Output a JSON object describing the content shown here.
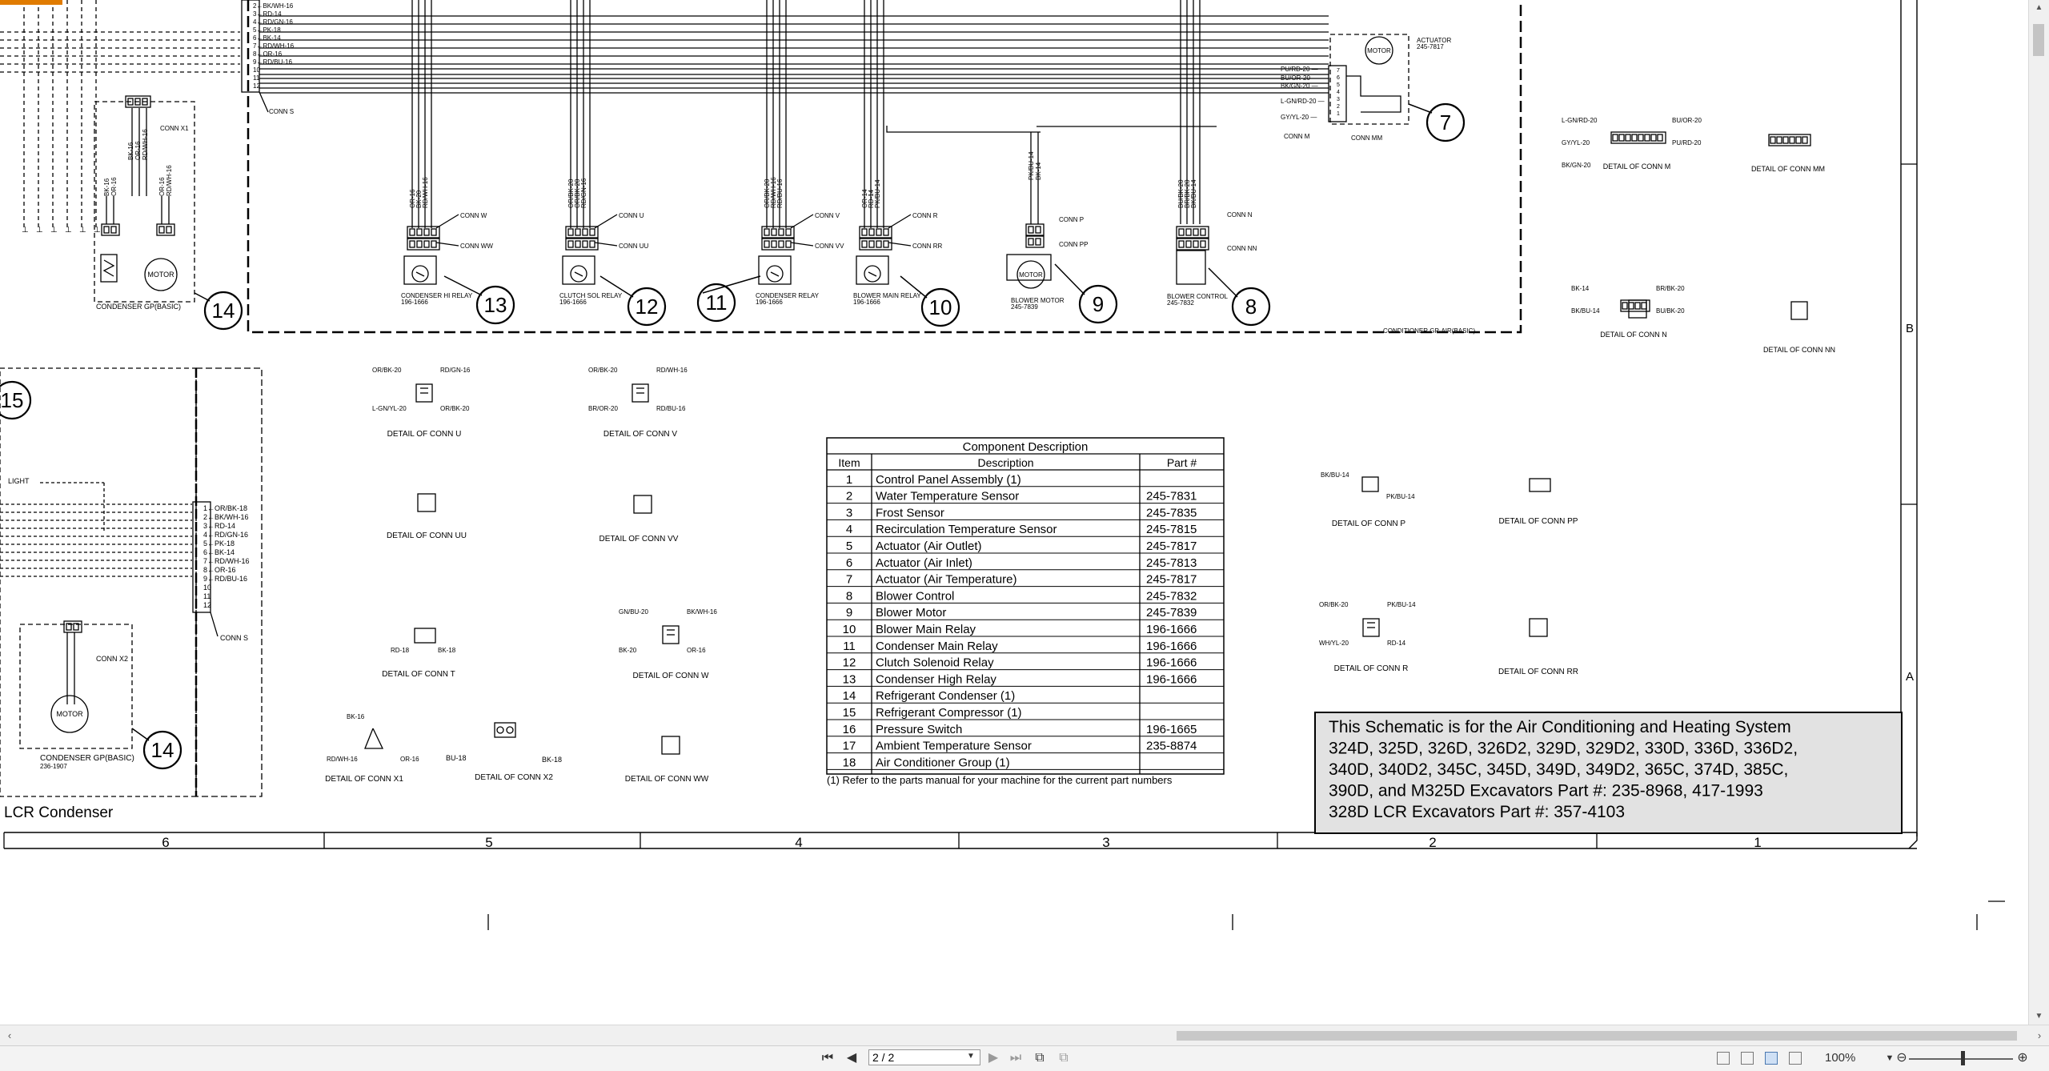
{
  "diagram": {
    "top_wires": [
      "2←BK/WH-16",
      "3←RD-14",
      "4←RD/GN-16",
      "5←PK-18",
      "6←BK-14",
      "7←RD/WH-16",
      "8←OR-16",
      "9←RD/BU-16",
      "10",
      "11",
      "12"
    ],
    "conn_s": "CONN S",
    "conn_x1": "CONN X1",
    "conn_x1_wires": [
      "BK-16",
      "OR-16",
      "RD/WH-16"
    ],
    "left_wires_a": [
      "BK-16",
      "OR-16"
    ],
    "left_wires_b": [
      "OR-16",
      "RD/WH-16"
    ],
    "motor": "MOTOR",
    "condenser_gp_top": "CONDENSER GP(BASIC)",
    "callouts": [
      "14",
      "13",
      "12",
      "11",
      "10",
      "9",
      "8",
      "7",
      "15",
      "14"
    ],
    "cond_hi_relay": {
      "name": "CONDENSER HI RELAY",
      "part": "196-1666",
      "conn_a": "CONN W",
      "conn_b": "CONN WW",
      "wires": [
        "OR-16",
        "BK-20",
        "RD/WH-16"
      ]
    },
    "clutch_sol_relay": {
      "name": "CLUTCH SOL RELAY",
      "part": "196-1666",
      "conn_a": "CONN U",
      "conn_b": "CONN UU",
      "wires": [
        "OR/BK-20",
        "OR/BK-20",
        "RD/GN-16"
      ]
    },
    "condenser_relay": {
      "name": "CONDENSER RELAY",
      "part": "196-1666",
      "conn_a": "CONN V",
      "conn_b": "CONN VV",
      "wires": [
        "OR/BK-20",
        "RD/WH-16",
        "RD/BU-16"
      ]
    },
    "blower_main_relay": {
      "name": "BLOWER MAIN RELAY",
      "part": "196-1666",
      "conn_a": "CONN R",
      "conn_b": "CONN RR",
      "wires": [
        "OR-14",
        "RD-14",
        "PK/BU-14"
      ]
    },
    "blower_motor": {
      "name": "BLOWER MOTOR",
      "part": "245-7839",
      "conn_a": "CONN P",
      "conn_b": "CONN PP",
      "wires": [
        "PK/BU-14",
        "BK-14"
      ]
    },
    "blower_control": {
      "name": "BLOWER CONTROL",
      "part": "245-7832",
      "conn_a": "CONN N",
      "conn_b": "CONN NN",
      "wires": [
        "BU/BK-20",
        "BR/BK-20",
        "BK/BU-14"
      ]
    },
    "actuator": {
      "name": "ACTUATOR",
      "part": "245-7817",
      "motor": "MOTOR",
      "wires": [
        "PU/RD-20",
        "BU/OR-20",
        "BK/GN-20",
        "L-GN/RD-20",
        "GY/YL-20"
      ],
      "conn_m": "CONN M",
      "conn_mm": "CONN MM"
    },
    "conditioner_gp": "CONDITIONER GP-AIR(BASIC)",
    "details_right": [
      {
        "title": "DETAIL OF CONN M",
        "wires": [
          "L-GN/RD-20",
          "BU/OR-20",
          "GY/YL-20",
          "PU/RD-20",
          "BK/GN-20"
        ]
      },
      {
        "title": "DETAIL OF CONN MM",
        "wires": []
      },
      {
        "title": "DETAIL OF CONN N",
        "wires": [
          "BK-14",
          "BR/BK-20",
          "BK/BU-14",
          "BU/BK-20"
        ]
      },
      {
        "title": "DETAIL OF CONN NN",
        "wires": []
      }
    ],
    "conn_u_detail": {
      "title": "DETAIL OF CONN U",
      "wires": [
        "OR/BK-20",
        "RD/GN-16",
        "L-GN/YL-20",
        "OR/BK-20"
      ]
    },
    "conn_v_detail": {
      "title": "DETAIL OF CONN V",
      "wires": [
        "OR/BK-20",
        "RD/WH-16",
        "BR/OR-20",
        "RD/BU-16"
      ]
    },
    "conn_uu_detail": "DETAIL OF CONN UU",
    "conn_vv_detail": "DETAIL OF CONN VV",
    "conn_t_detail": {
      "title": "DETAIL OF CONN T",
      "wires": [
        "RD-18",
        "BK-18"
      ]
    },
    "conn_w_detail": {
      "title": "DETAIL OF CONN W",
      "wires": [
        "GN/BU-20",
        "BK/WH-16",
        "BK-20",
        "OR-16"
      ]
    },
    "conn_x1_detail": {
      "title": "DETAIL OF CONN X1",
      "wires": [
        "BK-16",
        "RD/WH-16",
        "OR-16"
      ]
    },
    "conn_x2_detail": {
      "title": "DETAIL OF CONN X2",
      "wires": [
        "BU-18",
        "BK-18"
      ]
    },
    "conn_ww_detail": "DETAIL OF CONN WW",
    "conn_p_detail": {
      "title": "DETAIL OF CONN P",
      "wires": [
        "BK/BU-14",
        "PK/BU-14"
      ]
    },
    "conn_pp_detail": "DETAIL OF CONN PP",
    "conn_r_detail": {
      "title": "DETAIL OF CONN R",
      "wires": [
        "OR/BK-20",
        "PK/BU-14",
        "WH/YL-20",
        "RD-14"
      ]
    },
    "conn_rr_detail": "DETAIL OF CONN RR",
    "light": "LIGHT",
    "mid_wires": [
      "1←OR/BK-18",
      "2←BK/WH-16",
      "3←RD-14",
      "4←RD/GN-16",
      "5←PK-18",
      "6←BK-14",
      "7←RD/WH-16",
      "8←OR-16",
      "9←RD/BU-16",
      "10",
      "11",
      "12"
    ],
    "conn_s_mid": "CONN S",
    "conn_x2": "CONN X2",
    "motor2": "MOTOR",
    "condenser_gp_bottom": "CONDENSER GP(BASIC)",
    "condenser_gp_bottom_part": "236-1907",
    "lcr_condenser": "LCR Condenser",
    "grid_cols": [
      "6",
      "5",
      "4",
      "3",
      "2",
      "1"
    ],
    "grid_rows": [
      "B",
      "A"
    ]
  },
  "component_table": {
    "title": "Component Description",
    "headers": [
      "Item",
      "Description",
      "Part #"
    ],
    "rows": [
      [
        "1",
        "Control Panel Assembly (1)",
        ""
      ],
      [
        "2",
        "Water Temperature Sensor",
        "245-7831"
      ],
      [
        "3",
        "Frost Sensor",
        "245-7835"
      ],
      [
        "4",
        "Recirculation Temperature Sensor",
        "245-7815"
      ],
      [
        "5",
        "Actuator (Air Outlet)",
        "245-7817"
      ],
      [
        "6",
        "Actuator (Air Inlet)",
        "245-7813"
      ],
      [
        "7",
        "Actuator (Air Temperature)",
        "245-7817"
      ],
      [
        "8",
        "Blower Control",
        "245-7832"
      ],
      [
        "9",
        "Blower Motor",
        "245-7839"
      ],
      [
        "10",
        "Blower Main Relay",
        "196-1666"
      ],
      [
        "11",
        "Condenser Main Relay",
        "196-1666"
      ],
      [
        "12",
        "Clutch Solenoid Relay",
        "196-1666"
      ],
      [
        "13",
        "Condenser High Relay",
        "196-1666"
      ],
      [
        "14",
        "Refrigerant Condenser (1)",
        ""
      ],
      [
        "15",
        "Refrigerant Compressor (1)",
        ""
      ],
      [
        "16",
        "Pressure Switch",
        "196-1665"
      ],
      [
        "17",
        "Ambient Temperature Sensor",
        "235-8874"
      ],
      [
        "18",
        "Air Conditioner Group (1)",
        ""
      ]
    ],
    "footnote": "(1) Refer to the parts manual for your machine for the current part numbers"
  },
  "title_block": {
    "lines": [
      "This Schematic is for the Air Conditioning and Heating System",
      "324D, 325D, 326D, 326D2, 329D, 329D2, 330D, 336D, 336D2,",
      "340D, 340D2, 345C, 345D, 349D, 349D2, 365C, 374D, 385C,",
      "390D, and M325D Excavators Part #: 235-8968, 417-1993",
      "328D LCR Excavators Part #: 357-4103"
    ]
  },
  "viewer": {
    "page_indicator": "2 / 2",
    "zoom": "100%",
    "icons": [
      "first-page-icon",
      "prev-page-icon",
      "next-page-icon",
      "last-page-icon",
      "prev-view-icon",
      "next-view-icon",
      "single-page-icon",
      "continuous-icon",
      "facing-icon",
      "book-icon",
      "zoom-out-icon",
      "zoom-in-icon"
    ]
  },
  "colors": {
    "accent": "#e07b00",
    "title_bg": "#e6e6e6",
    "line": "#000000"
  }
}
